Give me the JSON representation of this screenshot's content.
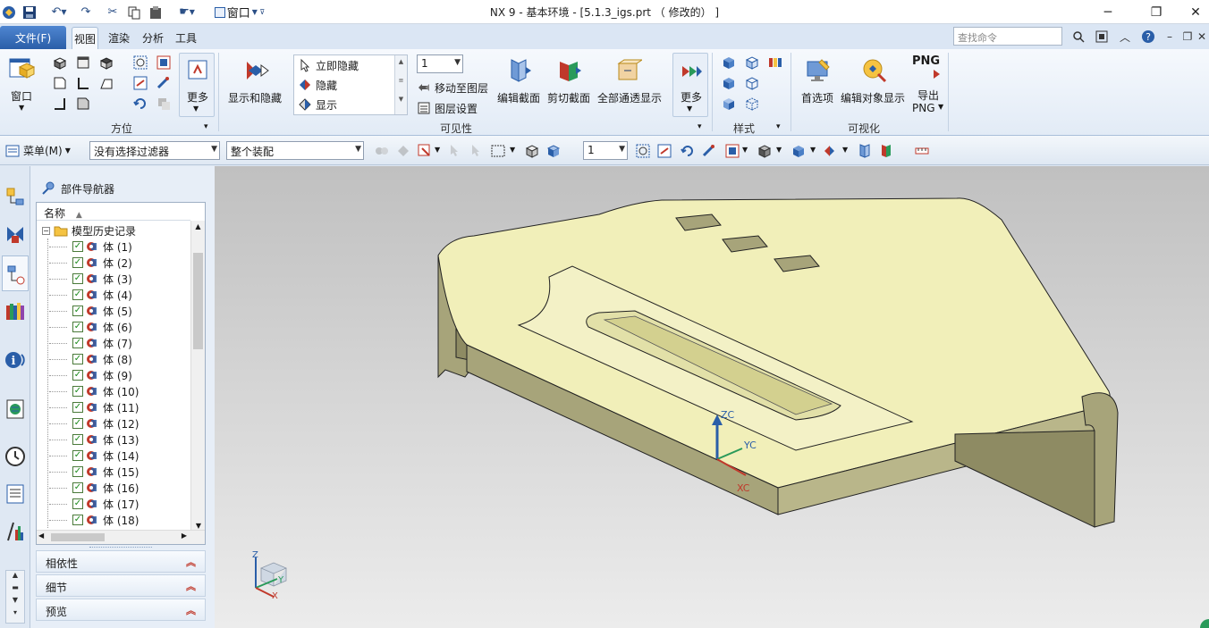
{
  "app": {
    "title": "NX 9 - 基本环境 - [5.1.3_igs.prt （ 修改的） ]"
  },
  "quick_access": {
    "window_menu_label": "窗口"
  },
  "ribbon_tabs": {
    "file": "文件(F)",
    "tabs": [
      "视图",
      "渲染",
      "分析",
      "工具"
    ],
    "active": "视图"
  },
  "search": {
    "placeholder": "查找命令"
  },
  "ribbon": {
    "window_button": "窗口",
    "more_button_1": "更多",
    "group_orientation": "方位",
    "show_hide_button": "显示和隐藏",
    "visibility_list": [
      "立即隐藏",
      "隐藏",
      "显示"
    ],
    "layer_value": "1",
    "move_to_layer": "移动至图层",
    "layer_settings": "图层设置",
    "group_visibility": "可见性",
    "edit_section": "编辑截面",
    "clip_section": "剪切截面",
    "show_all_through": "全部通透显示",
    "more_button_2": "更多",
    "group_style": "样式",
    "preferences": "首选项",
    "edit_object_display": "编辑对象显示",
    "export_png_top": "PNG",
    "export_png_label_1": "导出",
    "export_png_label_2": "PNG",
    "group_visualization": "可视化"
  },
  "selection_bar": {
    "menu_label": "菜单(M)",
    "filter_value": "没有选择过滤器",
    "scope_value": "整个装配",
    "layer_value": "1"
  },
  "navigator": {
    "title": "部件导航器",
    "column_header": "名称",
    "root": "模型历史记录",
    "items": [
      "体 (1)",
      "体 (2)",
      "体 (3)",
      "体 (4)",
      "体 (5)",
      "体 (6)",
      "体 (7)",
      "体 (8)",
      "体 (9)",
      "体 (10)",
      "体 (11)",
      "体 (12)",
      "体 (13)",
      "体 (14)",
      "体 (15)",
      "体 (16)",
      "体 (17)",
      "体 (18)"
    ],
    "panels": [
      "相依性",
      "细节",
      "预览"
    ]
  },
  "viewport": {
    "wcs_labels": {
      "z": "ZC",
      "y": "YC",
      "x": "XC"
    },
    "triad_labels": {
      "z": "Z",
      "y": "Y",
      "x": "X"
    }
  },
  "colors": {
    "model_face": "#f1efb9",
    "model_side": "#a7a47a",
    "accent_blue": "#2a5ea8"
  }
}
